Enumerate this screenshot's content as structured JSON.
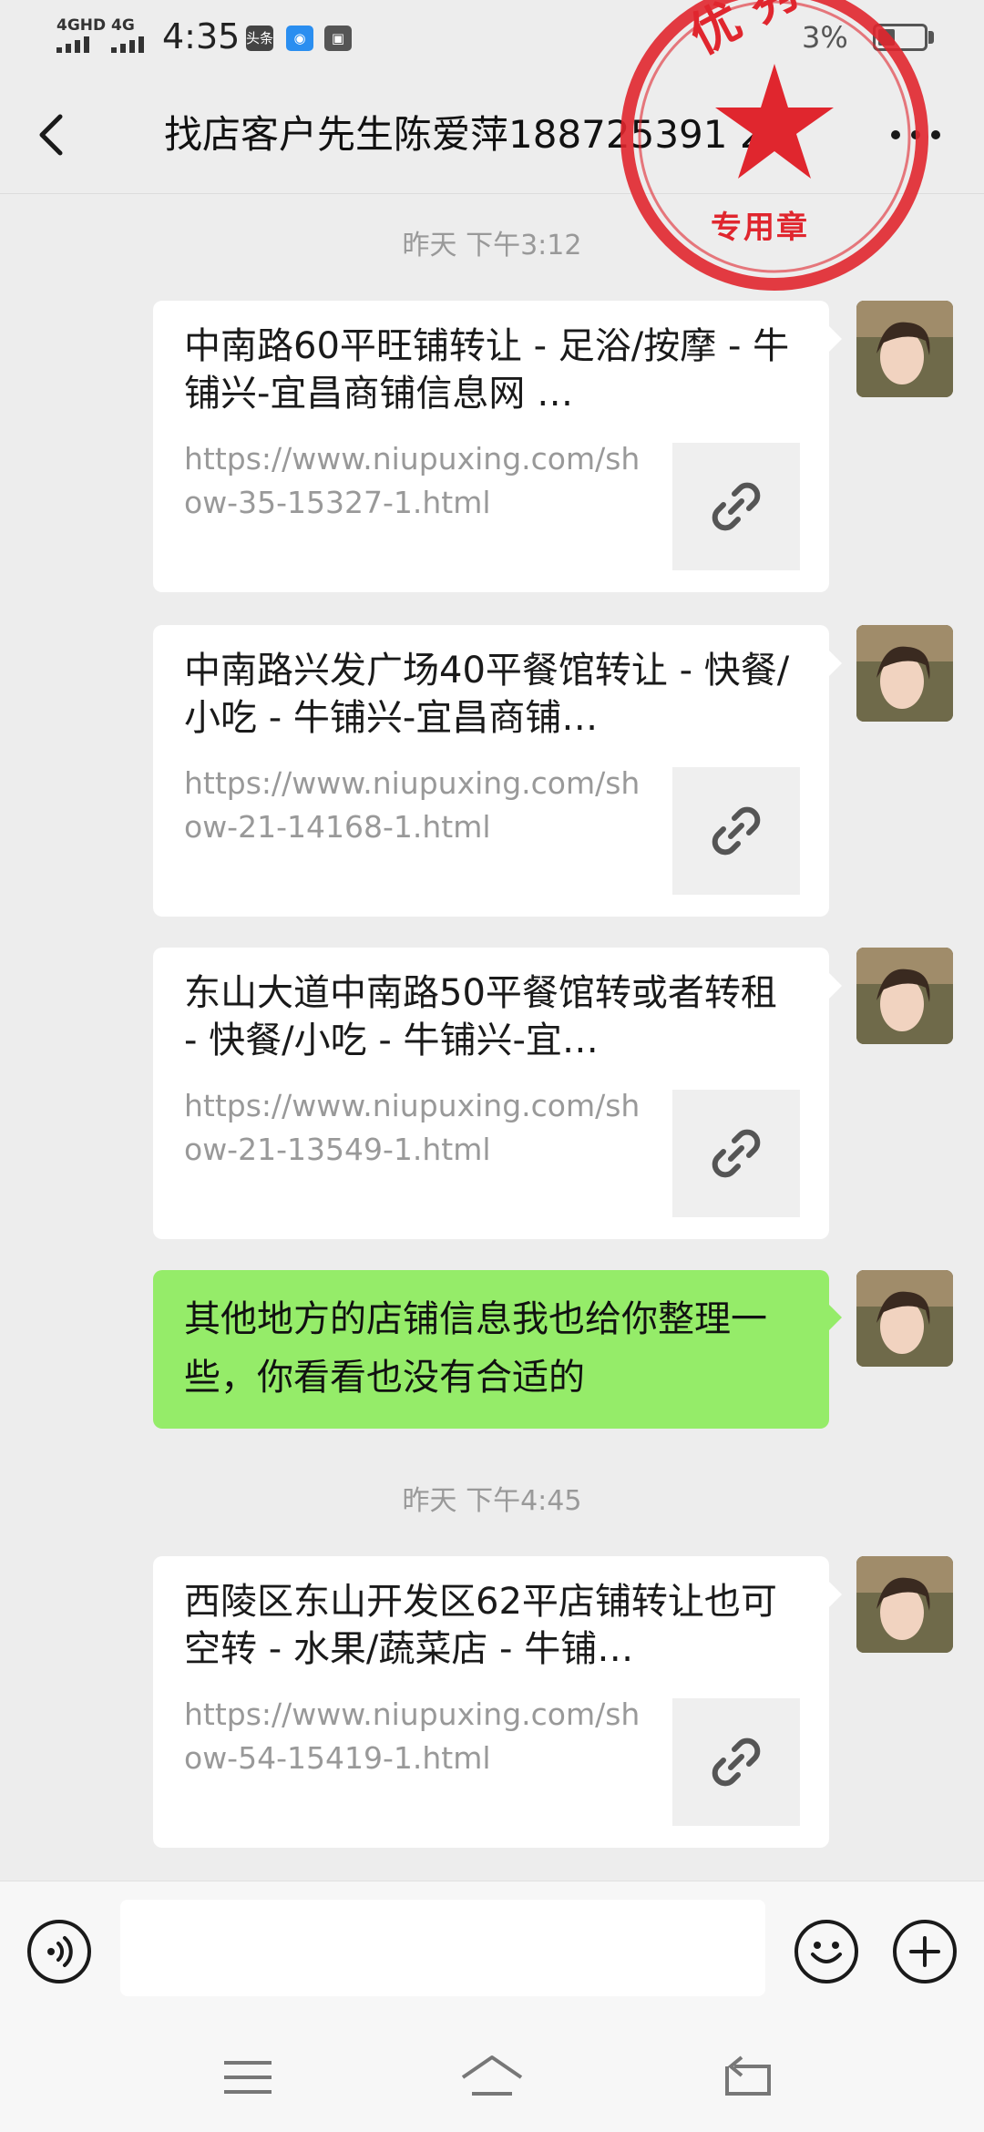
{
  "status_bar": {
    "signal_1": "4GHD",
    "signal_2": "4G",
    "time": "4:35",
    "badge_1": "头条",
    "battery": "3%"
  },
  "header": {
    "title": "找店客户先生陈爱萍188725391 2"
  },
  "seal": {
    "top_text": "优 秀",
    "label": "专用章",
    "color": "#e0262e"
  },
  "messages": {
    "timestamp_1": "昨天 下午3:12",
    "cards": [
      {
        "title": "中南路60平旺铺转让 - 足浴/按摩 - 牛铺兴-宜昌商铺信息网 …",
        "url": "https://www.niupuxing.com/show-35-15327-1.html"
      },
      {
        "title": "中南路兴发广场40平餐馆转让 - 快餐/小吃 - 牛铺兴-宜昌商铺…",
        "url": "https://www.niupuxing.com/show-21-14168-1.html"
      },
      {
        "title": "东山大道中南路50平餐馆转或者转租 - 快餐/小吃 - 牛铺兴-宜…",
        "url": "https://www.niupuxing.com/show-21-13549-1.html"
      }
    ],
    "text_message": "其他地方的店铺信息我也给你整理一些，你看看也没有合适的",
    "timestamp_2": "昨天 下午4:45",
    "card_4": {
      "title": "西陵区东山开发区62平店铺转让也可空转 - 水果/蔬菜店 - 牛铺…",
      "url": "https://www.niupuxing.com/show-54-15419-1.html"
    }
  },
  "input_bar": {
    "placeholder": ""
  },
  "colors": {
    "bubble_green": "#95ec69",
    "background": "#ededed"
  },
  "icons": [
    "back-arrow-icon",
    "more-icon",
    "link-icon",
    "voice-icon",
    "emoji-icon",
    "plus-icon",
    "menu-icon",
    "home-icon",
    "back-nav-icon"
  ]
}
